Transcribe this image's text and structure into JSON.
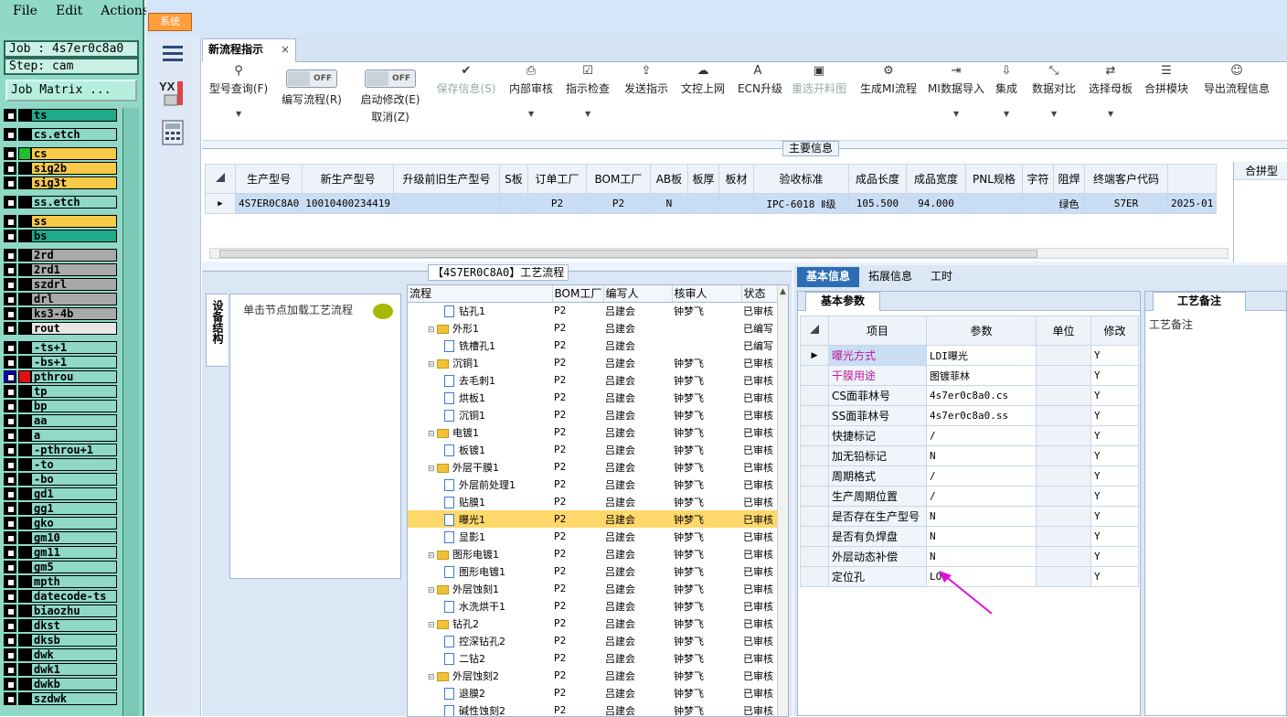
{
  "menu": {
    "file": "File",
    "edit": "Edit",
    "actions": "Actions"
  },
  "job": {
    "label": "Job : 4s7er0c8a0",
    "step": "Step: cam",
    "matrix_button": "Job Matrix ..."
  },
  "layers": [
    {
      "name": "ts",
      "color": "#1faa8a",
      "gap": false
    },
    {
      "name": "cs.etch",
      "color": "#8fd9c6",
      "gap": true
    },
    {
      "name": "cs",
      "color": "#f7c948",
      "gap": true,
      "sw": "#1fbf2f"
    },
    {
      "name": "sig2b",
      "color": "#f7c948",
      "gap": false
    },
    {
      "name": "sig3t",
      "color": "#f7c948",
      "gap": false
    },
    {
      "name": "ss.etch",
      "color": "#8fd9c6",
      "gap": true
    },
    {
      "name": "ss",
      "color": "#f7c948",
      "gap": true
    },
    {
      "name": "bs",
      "color": "#1faa8a",
      "gap": false
    },
    {
      "name": "2rd",
      "color": "#a9a9a9",
      "gap": true
    },
    {
      "name": "2rd1",
      "color": "#a9a9a9",
      "gap": false
    },
    {
      "name": "szdrl",
      "color": "#a9a9a9",
      "gap": false
    },
    {
      "name": "drl",
      "color": "#a9a9a9",
      "gap": false
    },
    {
      "name": "ks3-4b",
      "color": "#a9a9a9",
      "gap": false
    },
    {
      "name": "rout",
      "color": "#e6e6e6",
      "gap": false
    },
    {
      "name": "-ts+1",
      "color": "#8fd9c6",
      "gap": true
    },
    {
      "name": "-bs+1",
      "color": "#8fd9c6",
      "gap": false
    },
    {
      "name": "pthrou",
      "color": "#8fd9c6",
      "gap": false,
      "sw": "#e01010",
      "blue": true
    },
    {
      "name": "tp",
      "color": "#8fd9c6",
      "gap": false
    },
    {
      "name": "bp",
      "color": "#8fd9c6",
      "gap": false
    },
    {
      "name": "aa",
      "color": "#8fd9c6",
      "gap": false
    },
    {
      "name": "a",
      "color": "#8fd9c6",
      "gap": false
    },
    {
      "name": "-pthrou+1",
      "color": "#8fd9c6",
      "gap": false
    },
    {
      "name": "-to",
      "color": "#8fd9c6",
      "gap": false
    },
    {
      "name": "-bo",
      "color": "#8fd9c6",
      "gap": false
    },
    {
      "name": "gd1",
      "color": "#8fd9c6",
      "gap": false
    },
    {
      "name": "gg1",
      "color": "#8fd9c6",
      "gap": false
    },
    {
      "name": "gko",
      "color": "#8fd9c6",
      "gap": false
    },
    {
      "name": "gm10",
      "color": "#8fd9c6",
      "gap": false
    },
    {
      "name": "gm11",
      "color": "#8fd9c6",
      "gap": false
    },
    {
      "name": "gm5",
      "color": "#8fd9c6",
      "gap": false
    },
    {
      "name": "mpth",
      "color": "#8fd9c6",
      "gap": false
    },
    {
      "name": "datecode-ts",
      "color": "#8fd9c6",
      "gap": false
    },
    {
      "name": "biaozhu",
      "color": "#8fd9c6",
      "gap": false
    },
    {
      "name": "dkst",
      "color": "#8fd9c6",
      "gap": false
    },
    {
      "name": "dksb",
      "color": "#8fd9c6",
      "gap": false
    },
    {
      "name": "dwk",
      "color": "#8fd9c6",
      "gap": false
    },
    {
      "name": "dwk1",
      "color": "#8fd9c6",
      "gap": false
    },
    {
      "name": "dwkb",
      "color": "#8fd9c6",
      "gap": false
    },
    {
      "name": "szdwk",
      "color": "#8fd9c6",
      "gap": false
    }
  ],
  "system_button": "系统",
  "tab": {
    "label": "新流程指示",
    "close": "×"
  },
  "toolbar": [
    {
      "label": "型号查询(F)",
      "icon": "search-icon",
      "glyph": "⚲",
      "dropdown": true
    },
    {
      "label": "编写流程(R)",
      "icon": "toggle-off",
      "toggle": "OFF"
    },
    {
      "label": "启动修改(E)",
      "label2": "取消(Z)",
      "icon": "toggle-off",
      "toggle": "OFF"
    },
    {
      "label": "保存信息(S)",
      "icon": "check-icon",
      "glyph": "✔",
      "disabled": true
    },
    {
      "label": "内部审核",
      "icon": "printer-icon",
      "glyph": "⎙",
      "dropdown": true
    },
    {
      "label": "指示检查",
      "icon": "checkbox-icon",
      "glyph": "☑",
      "dropdown": true
    },
    {
      "label": "发送指示",
      "icon": "upload-icon",
      "glyph": "⇪"
    },
    {
      "label": "文控上网",
      "icon": "cloud-upload-icon",
      "glyph": "☁"
    },
    {
      "label": "ECN升级",
      "icon": "text-icon",
      "glyph": "A"
    },
    {
      "label": "重选开料图",
      "icon": "image-icon",
      "glyph": "▣",
      "disabled": true
    },
    {
      "label": "生成MI流程",
      "icon": "gears-icon",
      "glyph": "⚙"
    },
    {
      "label": "MI数据导入",
      "icon": "import-icon",
      "glyph": "⇥",
      "dropdown": true
    },
    {
      "label": "集成",
      "icon": "download-icon",
      "glyph": "⇩",
      "dropdown": true
    },
    {
      "label": "数据对比",
      "icon": "compare-icon",
      "glyph": "⤡",
      "dropdown": true
    },
    {
      "label": "选择母板",
      "icon": "shuffle-icon",
      "glyph": "⇄",
      "dropdown": true
    },
    {
      "label": "合拼模块",
      "icon": "list-icon",
      "glyph": "☰"
    },
    {
      "label": "导出流程信息",
      "icon": "smiley-icon",
      "glyph": "☺"
    }
  ],
  "main_info": {
    "title": "主要信息",
    "columns": [
      "生产型号",
      "新生产型号",
      "升级前旧生产型号",
      "S板",
      "订单工厂",
      "BOM工厂",
      "AB板",
      "板厚",
      "板材",
      "验收标准",
      "成品长度",
      "成品宽度",
      "PNL规格",
      "字符",
      "阻焊",
      "终端客户代码",
      ""
    ],
    "row": [
      "4S7ER0C8A0",
      "10010400234419",
      "",
      "",
      "P2",
      "P2",
      "N",
      "",
      "",
      "IPC-6018 Ⅱ级",
      "105.500",
      "94.000",
      "",
      "",
      "绿色",
      "S7ER",
      "2025-01"
    ],
    "right_header": "合拼型"
  },
  "process": {
    "title": "【4S7ER0C8A0】工艺流程",
    "vertical_tab": "设备结构",
    "hint": "单击节点加载工艺流程",
    "columns": [
      "流程",
      "BOM工厂",
      "编写人",
      "核审人",
      "状态"
    ],
    "rows": [
      {
        "name": "钻孔1",
        "type": "file",
        "bom": "P2",
        "writer": "吕建会",
        "reviewer": "钟梦飞",
        "status": "已审核"
      },
      {
        "name": "外形1",
        "type": "folder",
        "bom": "P2",
        "writer": "吕建会",
        "reviewer": "",
        "status": "已编写"
      },
      {
        "name": "铣槽孔1",
        "type": "file",
        "bom": "P2",
        "writer": "吕建会",
        "reviewer": "",
        "status": "已编写"
      },
      {
        "name": "沉铜1",
        "type": "folder",
        "bom": "P2",
        "writer": "吕建会",
        "reviewer": "钟梦飞",
        "status": "已审核"
      },
      {
        "name": "去毛刺1",
        "type": "file",
        "bom": "P2",
        "writer": "吕建会",
        "reviewer": "钟梦飞",
        "status": "已审核"
      },
      {
        "name": "烘板1",
        "type": "file",
        "bom": "P2",
        "writer": "吕建会",
        "reviewer": "钟梦飞",
        "status": "已审核"
      },
      {
        "name": "沉铜1",
        "type": "file",
        "bom": "P2",
        "writer": "吕建会",
        "reviewer": "钟梦飞",
        "status": "已审核"
      },
      {
        "name": "电镀1",
        "type": "folder",
        "bom": "P2",
        "writer": "吕建会",
        "reviewer": "钟梦飞",
        "status": "已审核"
      },
      {
        "name": "板镀1",
        "type": "file",
        "bom": "P2",
        "writer": "吕建会",
        "reviewer": "钟梦飞",
        "status": "已审核"
      },
      {
        "name": "外层干膜1",
        "type": "folder",
        "bom": "P2",
        "writer": "吕建会",
        "reviewer": "钟梦飞",
        "status": "已审核"
      },
      {
        "name": "外层前处理1",
        "type": "file",
        "bom": "P2",
        "writer": "吕建会",
        "reviewer": "钟梦飞",
        "status": "已审核"
      },
      {
        "name": "贴膜1",
        "type": "file",
        "bom": "P2",
        "writer": "吕建会",
        "reviewer": "钟梦飞",
        "status": "已审核"
      },
      {
        "name": "曝光1",
        "type": "file",
        "bom": "P2",
        "writer": "吕建会",
        "reviewer": "钟梦飞",
        "status": "已审核",
        "selected": true
      },
      {
        "name": "显影1",
        "type": "file",
        "bom": "P2",
        "writer": "吕建会",
        "reviewer": "钟梦飞",
        "status": "已审核"
      },
      {
        "name": "图形电镀1",
        "type": "folder",
        "bom": "P2",
        "writer": "吕建会",
        "reviewer": "钟梦飞",
        "status": "已审核"
      },
      {
        "name": "图形电镀1",
        "type": "file",
        "bom": "P2",
        "writer": "吕建会",
        "reviewer": "钟梦飞",
        "status": "已审核"
      },
      {
        "name": "外层蚀刻1",
        "type": "folder",
        "bom": "P2",
        "writer": "吕建会",
        "reviewer": "钟梦飞",
        "status": "已审核"
      },
      {
        "name": "水洗烘干1",
        "type": "file",
        "bom": "P2",
        "writer": "吕建会",
        "reviewer": "钟梦飞",
        "status": "已审核"
      },
      {
        "name": "钻孔2",
        "type": "folder",
        "bom": "P2",
        "writer": "吕建会",
        "reviewer": "钟梦飞",
        "status": "已审核"
      },
      {
        "name": "控深钻孔2",
        "type": "file",
        "bom": "P2",
        "writer": "吕建会",
        "reviewer": "钟梦飞",
        "status": "已审核"
      },
      {
        "name": "二钻2",
        "type": "file",
        "bom": "P2",
        "writer": "吕建会",
        "reviewer": "钟梦飞",
        "status": "已审核"
      },
      {
        "name": "外层蚀刻2",
        "type": "folder",
        "bom": "P2",
        "writer": "吕建会",
        "reviewer": "钟梦飞",
        "status": "已审核"
      },
      {
        "name": "退膜2",
        "type": "file",
        "bom": "P2",
        "writer": "吕建会",
        "reviewer": "钟梦飞",
        "status": "已审核"
      },
      {
        "name": "碱性蚀刻2",
        "type": "file",
        "bom": "P2",
        "writer": "吕建会",
        "reviewer": "钟梦飞",
        "status": "已审核"
      }
    ]
  },
  "detail": {
    "tabs": [
      "基本信息",
      "拓展信息",
      "工时"
    ],
    "basic_title": "基本参数",
    "columns": [
      "项目",
      "参数",
      "单位",
      "修改"
    ],
    "rows": [
      {
        "item": "曝光方式",
        "value": "LDI曝光",
        "unit": "",
        "mod": "Y",
        "magenta": true
      },
      {
        "item": "干膜用途",
        "value": "图镀菲林",
        "unit": "",
        "mod": "Y",
        "magenta": true
      },
      {
        "item": "CS面菲林号",
        "value": "4s7er0c8a0.cs",
        "unit": "",
        "mod": "Y"
      },
      {
        "item": "SS面菲林号",
        "value": "4s7er0c8a0.ss",
        "unit": "",
        "mod": "Y"
      },
      {
        "item": "快捷标记",
        "value": "/",
        "unit": "",
        "mod": "Y"
      },
      {
        "item": "加无铅标记",
        "value": "N",
        "unit": "",
        "mod": "Y"
      },
      {
        "item": "周期格式",
        "value": "/",
        "unit": "",
        "mod": "Y"
      },
      {
        "item": "生产周期位置",
        "value": "/",
        "unit": "",
        "mod": "Y"
      },
      {
        "item": "是否存在生产型号",
        "value": "N",
        "unit": "",
        "mod": "Y"
      },
      {
        "item": "是否有负焊盘",
        "value": "N",
        "unit": "",
        "mod": "Y"
      },
      {
        "item": "外层动态补偿",
        "value": "N",
        "unit": "",
        "mod": "Y"
      },
      {
        "item": "定位孔",
        "value": "LO",
        "unit": "",
        "mod": "Y"
      }
    ],
    "notes_title": "工艺备注",
    "notes_label": "工艺备注"
  },
  "colors": {
    "accent": "#2d6db5",
    "selected_row": "#ffd86b",
    "annotation_arrow": "#e010d8",
    "left_panel": "#8fd9c6"
  }
}
